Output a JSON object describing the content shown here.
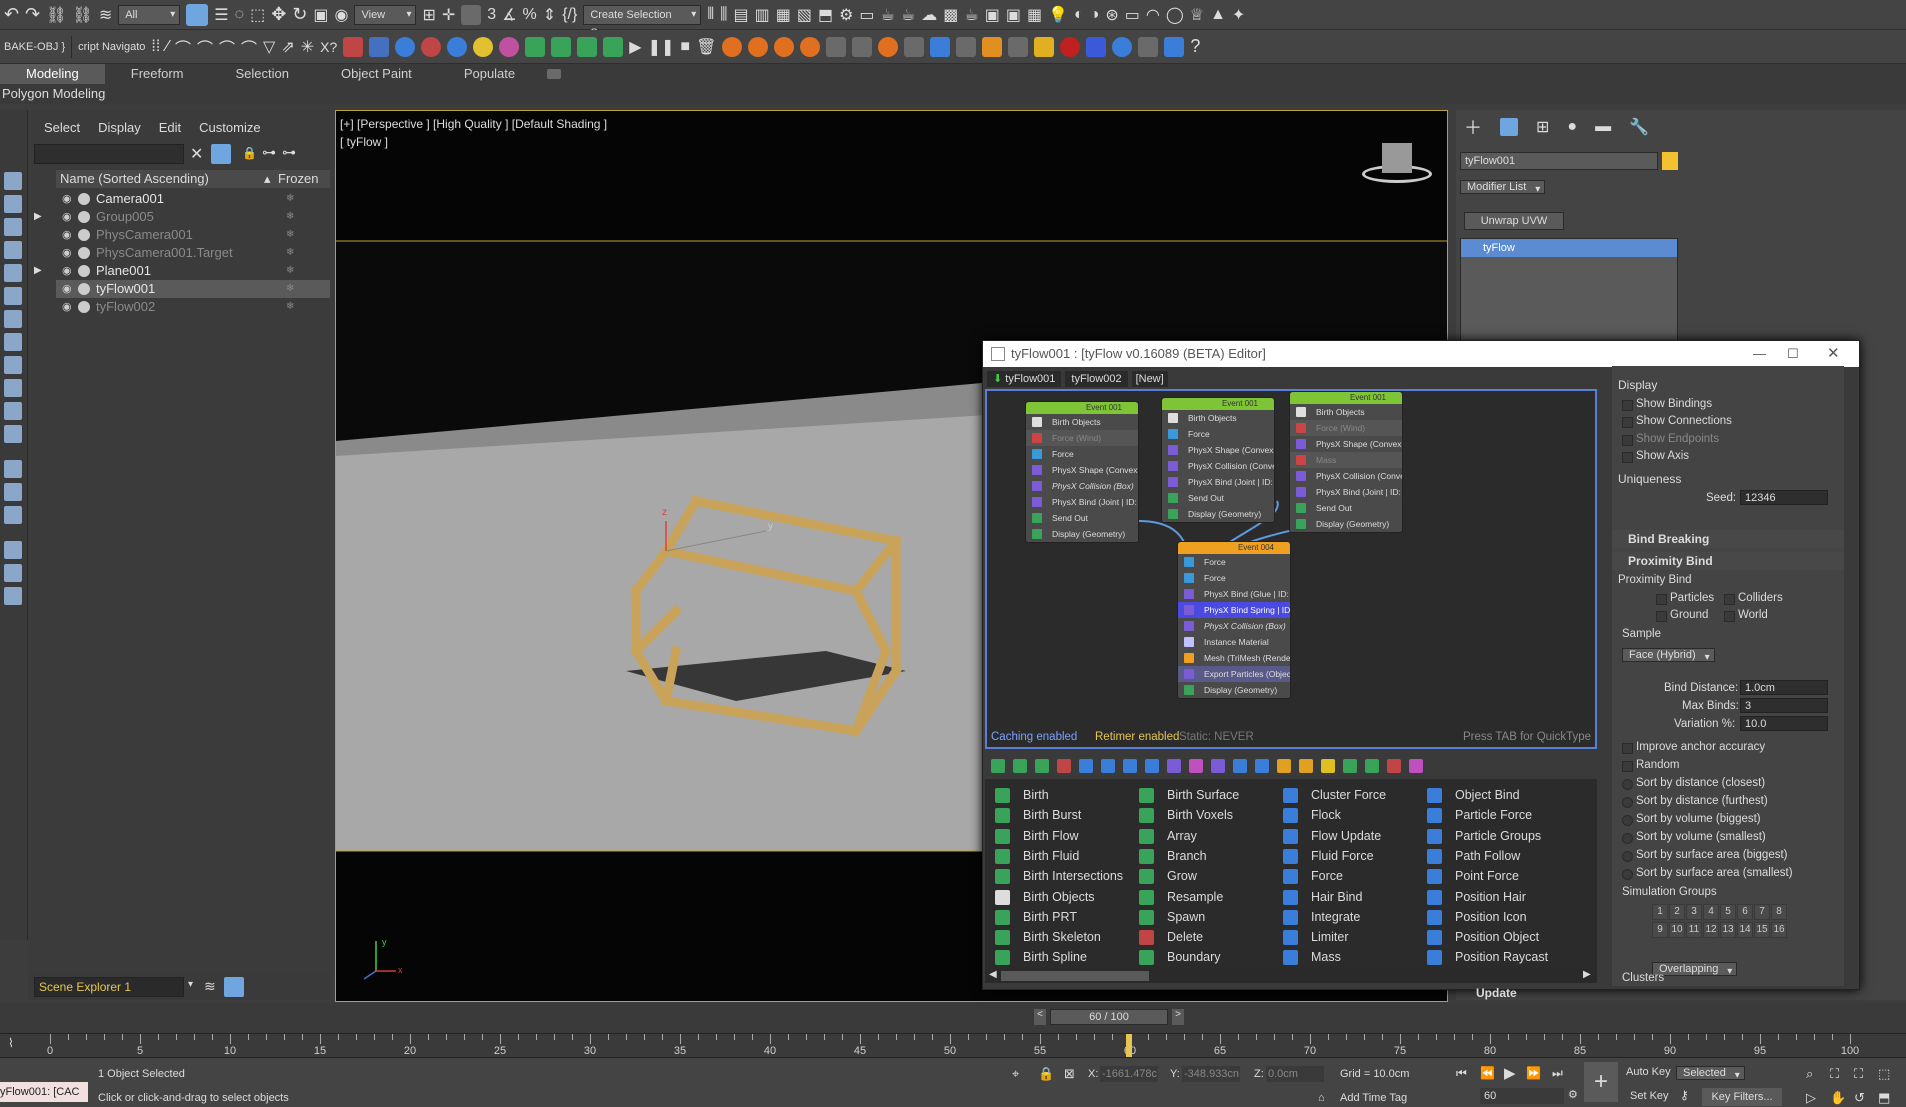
{
  "toolbar_top": {
    "selection_filter": "All",
    "ref_coord": "View",
    "named_selection": "Create Selection Se"
  },
  "toolbar_second": {
    "layer_label": "BAKE-OBJ }",
    "script_label": "cript Navigato"
  },
  "ribbon": {
    "tabs": [
      "Modeling",
      "Freeform",
      "Selection",
      "Object Paint",
      "Populate"
    ],
    "active_tab": "Modeling",
    "subtitle": "Polygon Modeling"
  },
  "scene_explorer": {
    "menu": [
      "Select",
      "Display",
      "Edit",
      "Customize"
    ],
    "col_name": "Name (Sorted Ascending)",
    "col_frozen": "Frozen",
    "rows": [
      {
        "name": "Camera001",
        "dim": false,
        "expand": false,
        "selected": false
      },
      {
        "name": "Group005",
        "dim": true,
        "expand": true,
        "selected": false
      },
      {
        "name": "PhysCamera001",
        "dim": true,
        "expand": false,
        "selected": false
      },
      {
        "name": "PhysCamera001.Target",
        "dim": true,
        "expand": false,
        "selected": false
      },
      {
        "name": "Plane001",
        "dim": false,
        "expand": true,
        "selected": false
      },
      {
        "name": "tyFlow001",
        "dim": false,
        "expand": false,
        "selected": true
      },
      {
        "name": "tyFlow002",
        "dim": true,
        "expand": false,
        "selected": false
      }
    ],
    "footer": "Scene Explorer 1"
  },
  "viewport": {
    "label": "[+] [Perspective ] [High Quality ] [Default Shading ]",
    "sublabel": "[ tyFlow ]",
    "gizmo_z": "z",
    "gizmo_y": "y",
    "axis_y": "y",
    "axis_x": "x"
  },
  "command_panel": {
    "object_name": "tyFlow001",
    "object_color": "#f2c230",
    "modifier_list": "Modifier List",
    "unwrap_button": "Unwrap UVW",
    "stack_item": "tyFlow"
  },
  "editor": {
    "title": "tyFlow001 : [tyFlow v0.16089 (BETA) Editor]",
    "tabs": [
      "tyFlow001",
      "tyFlow002",
      "[New]"
    ],
    "events": [
      {
        "title": "Event 001",
        "color": "#7ec437",
        "ops": [
          {
            "label": "Birth Objects",
            "c": "#ddd",
            "dim": false,
            "italic": false
          },
          {
            "label": "Force (Wind)",
            "c": "#c44",
            "dim": true,
            "italic": false
          },
          {
            "label": "Force",
            "c": "#3a9ad9",
            "dim": false,
            "italic": false
          },
          {
            "label": "PhysX Shape (Convex Hull)",
            "c": "#7b5bd6",
            "dim": false,
            "italic": false
          },
          {
            "label": "PhysX Collision (Box)",
            "c": "#7b5bd6",
            "dim": false,
            "italic": true
          },
          {
            "label": "PhysX Bind (Joint | ID: 0)",
            "c": "#7b5bd6",
            "dim": false,
            "italic": false
          },
          {
            "label": "Send Out",
            "c": "#3aa35a",
            "dim": false,
            "italic": false
          },
          {
            "label": "Display (Geometry)",
            "c": "#3aa35a",
            "dim": false,
            "italic": false
          }
        ]
      },
      {
        "title": "Event 001",
        "color": "#7ec437",
        "ops": [
          {
            "label": "Birth Objects",
            "c": "#ddd",
            "dim": false,
            "italic": false
          },
          {
            "label": "Force",
            "c": "#3a9ad9",
            "dim": false,
            "italic": false
          },
          {
            "label": "PhysX Shape (Convex Hull)",
            "c": "#7b5bd6",
            "dim": false,
            "italic": false
          },
          {
            "label": "PhysX Collision (Convex)",
            "c": "#7b5bd6",
            "dim": false,
            "italic": false
          },
          {
            "label": "PhysX Bind (Joint | ID: 0)",
            "c": "#7b5bd6",
            "dim": false,
            "italic": false
          },
          {
            "label": "Send Out",
            "c": "#3aa35a",
            "dim": false,
            "italic": false
          },
          {
            "label": "Display (Geometry)",
            "c": "#3aa35a",
            "dim": false,
            "italic": false
          }
        ]
      },
      {
        "title": "Event 001",
        "color": "#7ec437",
        "ops": [
          {
            "label": "Birth Objects",
            "c": "#ddd",
            "dim": false,
            "italic": false
          },
          {
            "label": "Force (Wind)",
            "c": "#c44",
            "dim": true,
            "italic": false
          },
          {
            "label": "PhysX Shape (Convex Hull)",
            "c": "#7b5bd6",
            "dim": false,
            "italic": false
          },
          {
            "label": "Mass",
            "c": "#c44",
            "dim": true,
            "italic": false
          },
          {
            "label": "PhysX Collision (Convex)",
            "c": "#7b5bd6",
            "dim": false,
            "italic": false
          },
          {
            "label": "PhysX Bind (Joint | ID: 0)",
            "c": "#7b5bd6",
            "dim": false,
            "italic": false
          },
          {
            "label": "Send Out",
            "c": "#3aa35a",
            "dim": false,
            "italic": false
          },
          {
            "label": "Display (Geometry)",
            "c": "#3aa35a",
            "dim": false,
            "italic": false
          }
        ]
      },
      {
        "title": "Event 004",
        "color": "#f0a020",
        "ops": [
          {
            "label": "Force",
            "c": "#3a9ad9",
            "dim": false,
            "italic": false
          },
          {
            "label": "Force",
            "c": "#3a9ad9",
            "dim": false,
            "italic": false
          },
          {
            "label": "PhysX Bind (Glue | ID: 0)",
            "c": "#7b5bd6",
            "dim": false,
            "italic": false
          },
          {
            "label": "PhysX Bind Spring | ID: ...",
            "c": "#7b5bd6",
            "dim": false,
            "italic": false,
            "hl": true
          },
          {
            "label": "PhysX Collision (Box)",
            "c": "#7b5bd6",
            "dim": false,
            "italic": true
          },
          {
            "label": "Instance Material",
            "c": "#c0c0ff",
            "dim": false,
            "italic": false
          },
          {
            "label": "Mesh (TriMesh (Render))",
            "c": "#f0a020",
            "dim": false,
            "italic": false
          },
          {
            "label": "Export Particles (Objects)",
            "c": "#7b5bd6",
            "dim": false,
            "italic": false,
            "hl2": true
          },
          {
            "label": "Display (Geometry)",
            "c": "#3aa35a",
            "dim": false,
            "italic": false
          }
        ]
      }
    ],
    "status_caching": "Caching enabled",
    "status_retimer": "Retimer enabled",
    "status_static": "Static: NEVER",
    "hint": "Press TAB for QuickType",
    "operators": [
      [
        "Birth",
        "Birth Burst",
        "Birth Flow",
        "Birth Fluid",
        "Birth Intersections",
        "Birth Objects",
        "Birth PRT",
        "Birth Skeleton",
        "Birth Spline"
      ],
      [
        "Birth Surface",
        "Birth Voxels",
        "Array",
        "Branch",
        "Grow",
        "Resample",
        "Spawn",
        "Delete",
        "Boundary"
      ],
      [
        "Cluster Force",
        "Flock",
        "Flow Update",
        "Fluid Force",
        "Force",
        "Hair Bind",
        "Integrate",
        "Limiter",
        "Mass"
      ],
      [
        "Object Bind",
        "Particle Force",
        "Particle Groups",
        "Path Follow",
        "Point Force",
        "Position Hair",
        "Position Icon",
        "Position Object",
        "Position Raycast"
      ]
    ]
  },
  "properties": {
    "display_head": "Display",
    "display_items": [
      "Show Bindings",
      "Show Connections",
      "Show Endpoints",
      "Show Axis"
    ],
    "uniqueness_head": "Uniqueness",
    "seed_label": "Seed:",
    "seed_value": "12346",
    "bind_breaking": "Bind Breaking",
    "proximity_bind": "Proximity Bind",
    "proximity_sub": "Proximity Bind",
    "cb_particles": "Particles",
    "cb_colliders": "Colliders",
    "cb_ground": "Ground",
    "cb_world": "World",
    "sample_head": "Sample",
    "sample_value": "Face (Hybrid)",
    "bind_distance_label": "Bind Distance:",
    "bind_distance_value": "1.0cm",
    "max_binds_label": "Max Binds:",
    "max_binds_value": "3",
    "variation_label": "Variation %:",
    "variation_value": "10.0",
    "improve_anchor": "Improve anchor accuracy",
    "random": "Random",
    "sort_options": [
      "Sort by distance (closest)",
      "Sort by distance (furthest)",
      "Sort by volume (biggest)",
      "Sort by volume (smallest)",
      "Sort by surface area (biggest)",
      "Sort by surface area (smallest)"
    ],
    "sim_groups": "Simulation Groups",
    "group_nums": [
      "1",
      "2",
      "3",
      "4",
      "5",
      "6",
      "7",
      "8",
      "9",
      "10",
      "11",
      "12",
      "13",
      "14",
      "15",
      "16"
    ],
    "overlap_value": "Overlapping",
    "clusters": "Clusters",
    "update": "Update"
  },
  "timeline": {
    "frame_display": "60 / 100",
    "ticks": [
      "0",
      "5",
      "10",
      "15",
      "20",
      "25",
      "30",
      "35",
      "40",
      "45",
      "50",
      "55",
      "60",
      "65",
      "70",
      "75",
      "80",
      "85",
      "90",
      "95",
      "100"
    ]
  },
  "status": {
    "maxscript": "yFlow001: [CAC",
    "selected": "1 Object Selected",
    "hint": "Click or click-and-drag to select objects",
    "x_label": "X:",
    "x_value": "-1661.478c",
    "y_label": "Y:",
    "y_value": "-348.933cn",
    "z_label": "Z:",
    "z_value": "0.0cm",
    "grid": "Grid = 10.0cm",
    "add_time_tag": "Add Time Tag",
    "frame_value": "60",
    "auto_key": "Auto Key",
    "set_key": "Set Key",
    "key_mode": "Selected",
    "key_filters": "Key Filters..."
  }
}
